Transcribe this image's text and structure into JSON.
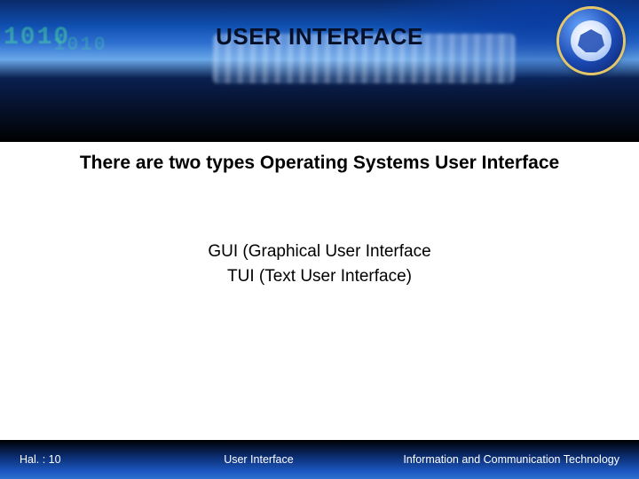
{
  "title": "USER INTERFACE",
  "subtitle": "There are two types Operating Systems User Interface",
  "bullets": [
    "GUI (Graphical User Interface",
    "TUI (Text User Interface)"
  ],
  "footer": {
    "page": "Hal. : 10",
    "center": "User Interface",
    "right": "Information and Communication Technology"
  }
}
